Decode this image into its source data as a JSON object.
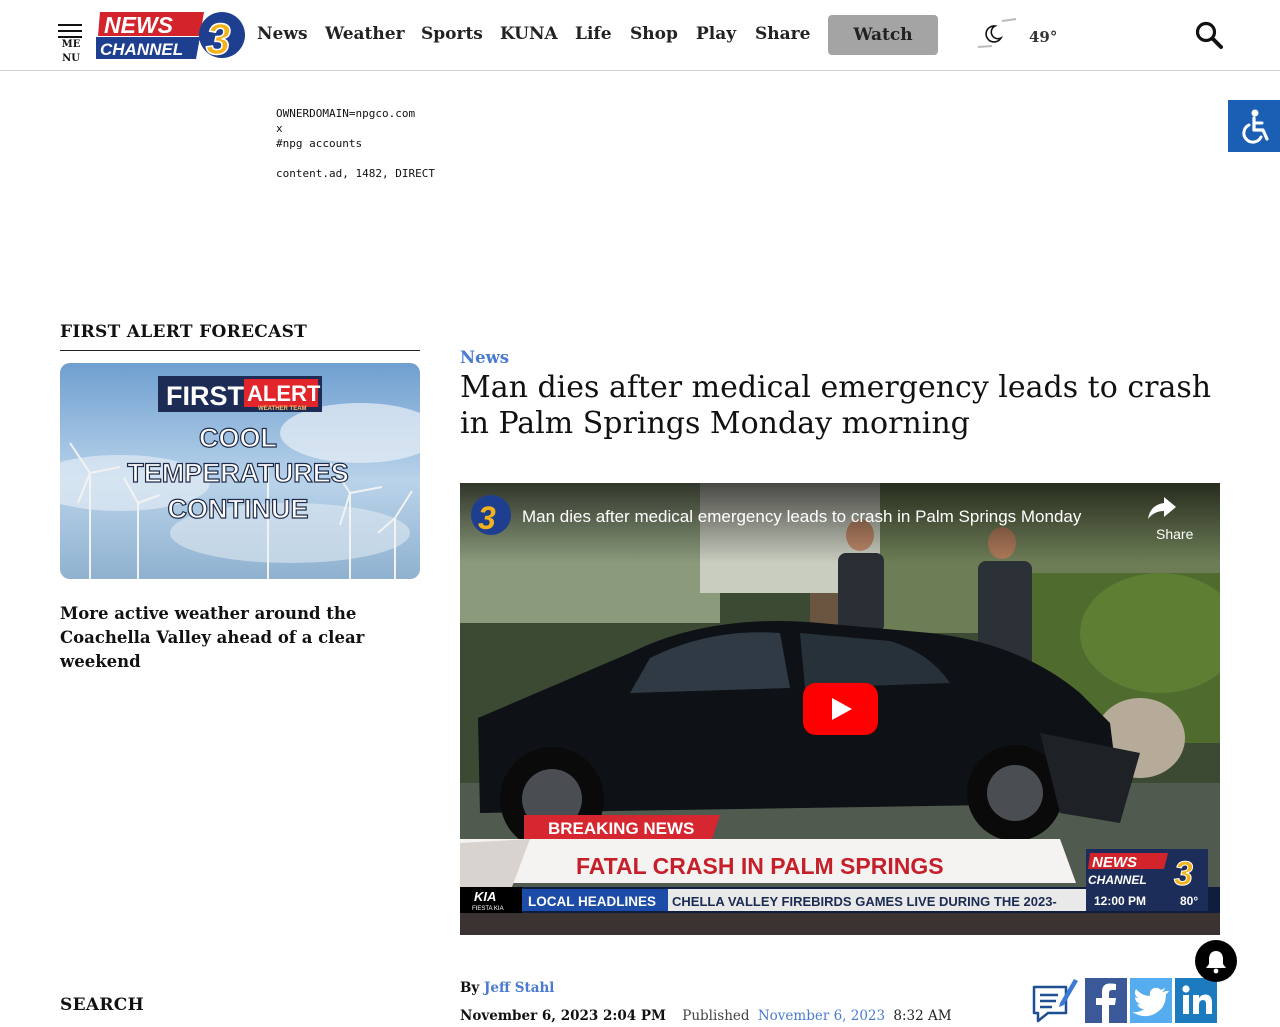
{
  "header": {
    "menu_label": "MENU",
    "logo": {
      "line1": "NEWS",
      "line2": "CHANNEL",
      "number": "3"
    },
    "nav": [
      "News",
      "Weather",
      "Sports",
      "KUNA",
      "Life",
      "Shop",
      "Play",
      "Share"
    ],
    "watch_label": "Watch",
    "temperature": "49°"
  },
  "ad_text": "OWNERDOMAIN=npgco.com\nx\n#npg accounts\n\ncontent.ad, 1482, DIRECT\n#",
  "sidebar": {
    "forecast_heading": "FIRST ALERT FORECAST",
    "forecast_image": {
      "badge_first": "FIRST",
      "badge_alert": "ALERT",
      "badge_sub": "WEATHER TEAM",
      "line1": "COOL",
      "line2": "TEMPERATURES",
      "line3": "CONTINUE"
    },
    "forecast_caption": "More active weather around the Coachella Valley ahead of a clear weekend",
    "search_heading": "SEARCH"
  },
  "article": {
    "category": "News",
    "headline": "Man dies after medical emergency leads to crash in Palm Springs Monday morning",
    "video": {
      "title": "Man dies after medical emergency leads to crash in Palm Springs Monday …",
      "share_label": "Share",
      "breaking_label": "BREAKING NEWS",
      "lower_third": "FATAL CRASH IN PALM SPRINGS",
      "sponsor_brand": "KIA",
      "sponsor_name": "FIESTA KIA",
      "ticker_label": "LOCAL HEADLINES",
      "ticker_text": "CHELLA VALLEY FIREBIRDS GAMES LIVE DURING THE 2023-",
      "bug_line1": "NEWS",
      "bug_line2": "CHANNEL",
      "bug_number": "3",
      "bug_time": "12:00 PM",
      "bug_temp": "80°"
    },
    "byline_prefix": "By",
    "author": "Jeff Stahl",
    "updated": "November 6, 2023 2:04 PM",
    "published_label": "Published",
    "published_date": "November 6, 2023",
    "published_time": "8:32 AM"
  },
  "colors": {
    "link_blue": "#4a7bd1",
    "logo_red": "#d3242b",
    "logo_blue": "#1e3f8f",
    "logo_gold": "#f2b21b",
    "watch_bg": "#a4a4a4",
    "facebook": "#3b5998",
    "twitter": "#55acee",
    "linkedin": "#1c7abf"
  },
  "icons": [
    "menu-icon",
    "search-icon",
    "moon-icon",
    "accessibility-icon",
    "play-icon",
    "share-arrow-icon",
    "notes-icon",
    "facebook-icon",
    "twitter-icon",
    "linkedin-icon",
    "bell-icon"
  ]
}
